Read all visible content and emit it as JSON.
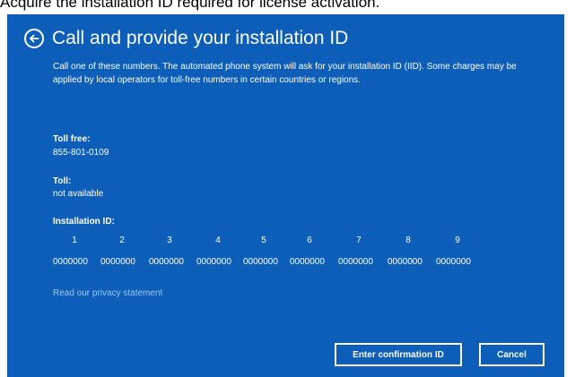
{
  "caption": "Acquire the installation ID required for license activation.",
  "dialog": {
    "title": "Call and provide your installation ID",
    "description": "Call one of these numbers. The automated phone system will ask for your installation ID (IID). Some charges may be applied by local operators for toll-free numbers in certain countries or regions.",
    "toll_free_label": "Toll free:",
    "toll_free_value": "855-801-0109",
    "toll_label": "Toll:",
    "toll_value": "not available",
    "iid_label": "Installation ID:",
    "iid_groups": [
      {
        "num": "1",
        "block": "0000000"
      },
      {
        "num": "2",
        "block": "0000000"
      },
      {
        "num": "3",
        "block": "0000000"
      },
      {
        "num": "4",
        "block": "0000000"
      },
      {
        "num": "5",
        "block": "0000000"
      },
      {
        "num": "6",
        "block": "0000000"
      },
      {
        "num": "7",
        "block": "0000000"
      },
      {
        "num": "8",
        "block": "0000000"
      },
      {
        "num": "9",
        "block": "0000000"
      }
    ],
    "privacy_link": "Read our privacy statement",
    "confirm_button": "Enter confirmation ID",
    "cancel_button": "Cancel"
  },
  "icons": {
    "back": "back-arrow-circle-icon"
  },
  "colors": {
    "panel_background": "#0c5eb9",
    "text": "#ffffff",
    "link": "#9fc6f0"
  }
}
